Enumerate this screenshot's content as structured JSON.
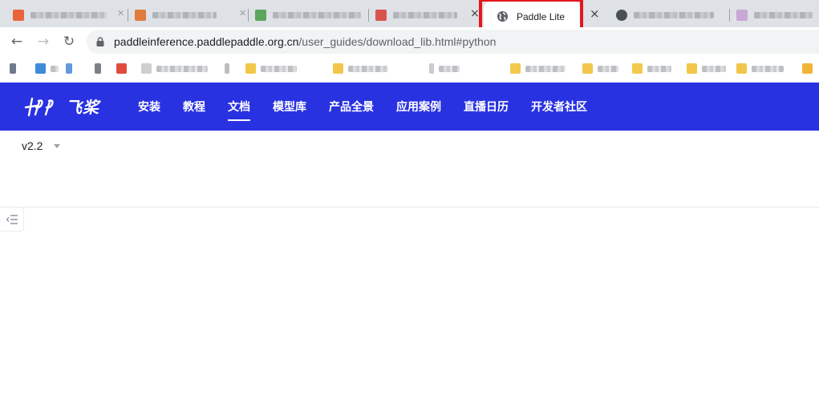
{
  "browser": {
    "tabs": [
      {
        "favicon_color": "#e8653a"
      },
      {
        "favicon_color": "#e07b3c"
      },
      {
        "favicon_color": "#5ba55d"
      },
      {
        "favicon_color": "#d9534f"
      }
    ],
    "active_tab": {
      "title": "Paddle Lite",
      "close_glyph": "×",
      "icon": "globe-icon"
    },
    "trailing_tabs": [
      {
        "favicon_color": "#4a4f57"
      },
      {
        "favicon_color": "#c9a7d6"
      }
    ],
    "highlight_color": "#e5161b",
    "url": {
      "host": "paddleinference.paddlepaddle.org.cn",
      "path": "/user_guides/download_lib.html#python"
    },
    "bookmark_colors": [
      "#6f7a90",
      "#3d8bd9",
      "#5f9bd8",
      "#e04b3c",
      "#cfcfcf",
      "#f1c84a",
      "#bdbdbd",
      "#f2c64b",
      "#cccccc",
      "#f3c94e",
      "#f2c64b",
      "#f3c94e",
      "#f2c64b",
      "#f2c64b",
      "#f3c94e",
      "#f1b437"
    ]
  },
  "site": {
    "brand_color": "#2932e1",
    "logo_text": "飞桨",
    "nav": [
      {
        "label": "安装",
        "active": false
      },
      {
        "label": "教程",
        "active": false
      },
      {
        "label": "文档",
        "active": true
      },
      {
        "label": "模型库",
        "active": false
      },
      {
        "label": "产品全景",
        "active": false
      },
      {
        "label": "应用案例",
        "active": false
      },
      {
        "label": "直播日历",
        "active": false
      },
      {
        "label": "开发者社区",
        "active": false
      }
    ]
  },
  "page": {
    "version": "v2.2",
    "toc_icon": "toc-list-icon"
  }
}
